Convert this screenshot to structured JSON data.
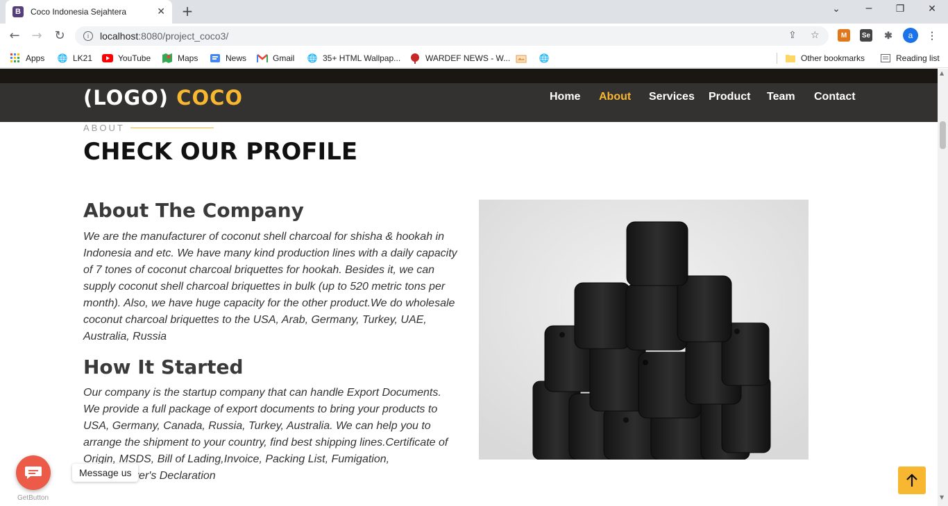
{
  "browser": {
    "tab_title": "Coco Indonesia Sejahtera",
    "tab_favicon": "B",
    "url_host": "localhost",
    "url_rest": ":8080/project_coco3/",
    "avatar": "a",
    "bookmarks": [
      {
        "label": "Apps",
        "icon": "apps-icon"
      },
      {
        "label": "LK21",
        "icon": "globe-icon"
      },
      {
        "label": "YouTube",
        "icon": "youtube-icon"
      },
      {
        "label": "Maps",
        "icon": "maps-icon"
      },
      {
        "label": "News",
        "icon": "news-icon"
      },
      {
        "label": "Gmail",
        "icon": "gmail-icon"
      },
      {
        "label": "35+ HTML Wallpap...",
        "icon": "globe-icon"
      },
      {
        "label": "WARDEF NEWS - W...",
        "icon": "wardef-icon"
      }
    ],
    "other_bookmarks": "Other bookmarks",
    "reading_list": "Reading list"
  },
  "site": {
    "logo_main": "(LOGO)",
    "logo_accent": "COCO",
    "nav": [
      "Home",
      "About",
      "Services",
      "Product",
      "Team",
      "Contact"
    ],
    "active_nav": "About",
    "accent_color": "#f7b731"
  },
  "about": {
    "label": "ABOUT",
    "title": "CHECK OUR PROFILE",
    "company_heading": "About The Company",
    "company_text": "We are the manufacturer of coconut shell charcoal for shisha & hookah in Indonesia and etc. We have many kind production lines with a daily capacity of 7 tones of coconut charcoal briquettes for hookah. Besides it, we can supply coconut shell charcoal briquettes in bulk (up to 520 metric tons per month). Also, we have huge capacity for the other product.We do wholesale coconut charcoal briquettes to the USA, Arab, Germany, Turkey, UAE, Australia, Russia",
    "started_heading": "How It Started",
    "started_text": "Our company is the startup company that can handle Export Documents. We provide a full package of export documents to bring your products to USA, Germany, Canada, Russia, Turkey, Australia. We can help you to arrange the shipment to your country, find best shipping lines.Certificate of Origin, MSDS, Bill of Lading,Invoice, Packing List, Fumigation, Manufacturer's Declaration"
  },
  "widgets": {
    "message_label": "Message us",
    "getbutton": "GetButton"
  }
}
